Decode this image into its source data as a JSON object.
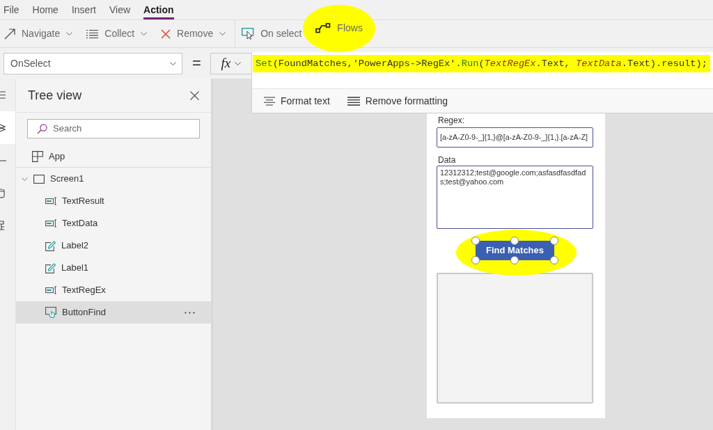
{
  "menu_tabs": [
    {
      "label": "File",
      "selected": false
    },
    {
      "label": "Home",
      "selected": false
    },
    {
      "label": "Insert",
      "selected": false
    },
    {
      "label": "View",
      "selected": false
    },
    {
      "label": "Action",
      "selected": true
    }
  ],
  "toolbar": {
    "groups": [
      [
        {
          "label": "Navigate",
          "dropdown": true,
          "highlighted": false
        },
        {
          "label": "Collect",
          "dropdown": true,
          "highlighted": false
        },
        {
          "label": "Remove",
          "dropdown": true,
          "highlighted": false
        }
      ],
      [
        {
          "label": "On select",
          "dropdown": false,
          "highlighted": false
        },
        {
          "label": "Flows",
          "dropdown": false,
          "highlighted": true
        }
      ]
    ]
  },
  "formula_bar": {
    "property": "OnSelect",
    "equals": "=",
    "fx": "fx",
    "formula": {
      "highlighted": true,
      "tokens": [
        {
          "text": "Set",
          "kind": "function"
        },
        {
          "text": "(FoundMatches,'PowerApps->RegEx'.",
          "kind": "plain"
        },
        {
          "text": "Run",
          "kind": "function"
        },
        {
          "text": "(",
          "kind": "plain"
        },
        {
          "text": "TextRegEx",
          "kind": "control"
        },
        {
          "text": ".Text, ",
          "kind": "plain"
        },
        {
          "text": "TextData",
          "kind": "control"
        },
        {
          "text": ".Text).result);",
          "kind": "plain"
        }
      ]
    },
    "tools": [
      "Format text",
      "Remove formatting"
    ]
  },
  "left_rail": [
    {
      "selected": false
    },
    {
      "selected": true
    },
    {
      "selected": false
    },
    {
      "selected": false
    },
    {
      "selected": false
    }
  ],
  "tree_view": {
    "title": "Tree view",
    "search": {
      "placeholder": "Search"
    },
    "app": {
      "label": "App"
    },
    "items": [
      {
        "label": "Screen1",
        "kind": "screen",
        "expanded": true,
        "selected": false,
        "children": [
          {
            "label": "TextResult",
            "kind": "text_input",
            "selected": false
          },
          {
            "label": "TextData",
            "kind": "text_input",
            "selected": false
          },
          {
            "label": "Label2",
            "kind": "label",
            "selected": false
          },
          {
            "label": "Label1",
            "kind": "label",
            "selected": false
          },
          {
            "label": "TextRegEx",
            "kind": "text_input",
            "selected": false
          },
          {
            "label": "ButtonFind",
            "kind": "button",
            "selected": true
          }
        ]
      }
    ]
  },
  "canvas": {
    "fields": [
      {
        "label": "Regex:",
        "value": "[a-zA-Z0-9-_]{1,}@[a-zA-Z0-9-_]{1,}.[a-zA-Z]",
        "kind": "single_line"
      },
      {
        "label": "Data",
        "value": "12312312;test@google.com;asfasdfasdfads;test@yahoo.com",
        "kind": "multi_line"
      }
    ],
    "button": {
      "label": "Find Matches",
      "selected": true,
      "highlighted": true
    }
  }
}
